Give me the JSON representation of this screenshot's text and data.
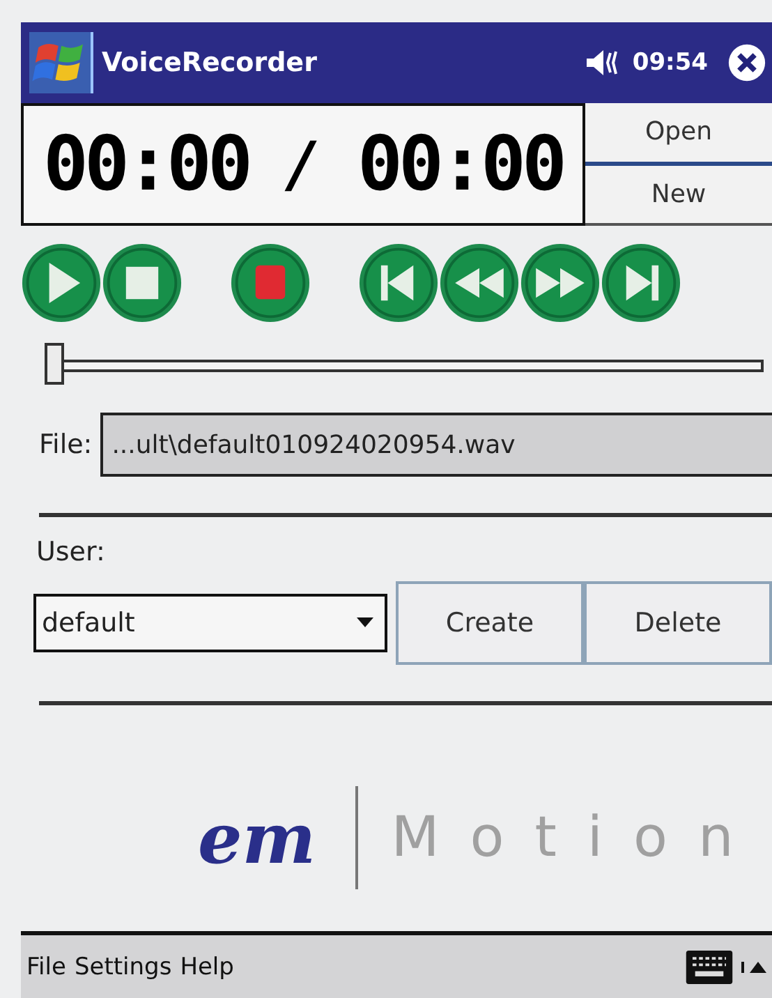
{
  "title_bar": {
    "title": "VoiceRecorder",
    "time": "09:54"
  },
  "timer": {
    "elapsed": "00:00",
    "separator": "/",
    "total": "00:00"
  },
  "file_buttons": [
    "Open",
    "New"
  ],
  "transport": [
    {
      "kind": "play"
    },
    {
      "kind": "stop"
    },
    {
      "kind": "record"
    },
    {
      "kind": "skip-back"
    },
    {
      "kind": "rewind"
    },
    {
      "kind": "forward"
    },
    {
      "kind": "skip-forward"
    }
  ],
  "position_slider": {
    "level": 0
  },
  "file": {
    "label": "File:",
    "value": "...ult\\default010924020954.wav"
  },
  "user": {
    "label": "User:",
    "value": "default",
    "buttons": [
      "Create",
      "Delete"
    ]
  },
  "logo": {
    "mark": "em",
    "name": "Motion"
  },
  "menu_bar": {
    "items": [
      "File",
      "Settings",
      "Help"
    ]
  }
}
